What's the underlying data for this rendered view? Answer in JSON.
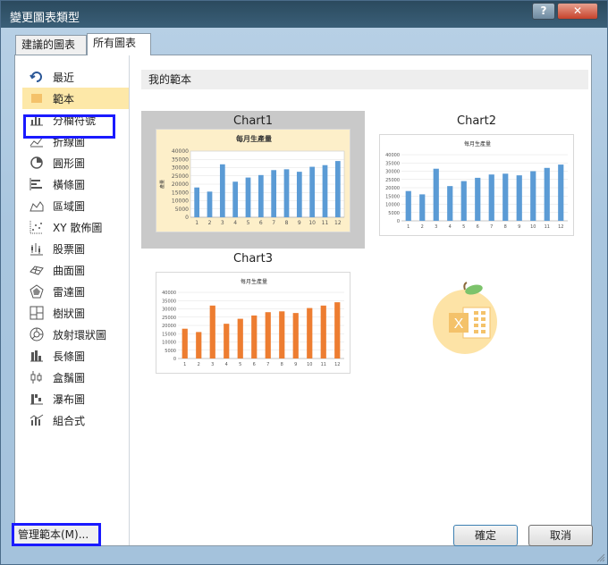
{
  "window": {
    "title": "變更圖表類型"
  },
  "tabs": [
    {
      "label": "建議的圖表",
      "active": false
    },
    {
      "label": "所有圖表",
      "active": true
    }
  ],
  "sidebar": {
    "items": [
      {
        "label": "最近",
        "icon": "recent-icon"
      },
      {
        "label": "範本",
        "icon": "folder-icon",
        "selected": true
      },
      {
        "label": "分欄符號",
        "icon": "column-chart-icon"
      },
      {
        "label": "折線圖",
        "icon": "line-chart-icon"
      },
      {
        "label": "圓形圖",
        "icon": "pie-chart-icon"
      },
      {
        "label": "橫條圖",
        "icon": "bar-chart-icon"
      },
      {
        "label": "區域圖",
        "icon": "area-chart-icon"
      },
      {
        "label": "XY 散佈圖",
        "icon": "scatter-chart-icon"
      },
      {
        "label": "股票圖",
        "icon": "stock-chart-icon"
      },
      {
        "label": "曲面圖",
        "icon": "surface-chart-icon"
      },
      {
        "label": "雷達圖",
        "icon": "radar-chart-icon"
      },
      {
        "label": "樹狀圖",
        "icon": "treemap-chart-icon"
      },
      {
        "label": "放射環狀圖",
        "icon": "sunburst-chart-icon"
      },
      {
        "label": "長條圖",
        "icon": "histogram-chart-icon"
      },
      {
        "label": "盒鬚圖",
        "icon": "box-whisker-chart-icon"
      },
      {
        "label": "瀑布圖",
        "icon": "waterfall-chart-icon"
      },
      {
        "label": "組合式",
        "icon": "combo-chart-icon"
      }
    ]
  },
  "content": {
    "section_title": "我的範本",
    "templates": [
      {
        "name": "Chart1",
        "selected": true
      },
      {
        "name": "Chart2",
        "selected": false
      },
      {
        "name": "Chart3",
        "selected": false
      }
    ]
  },
  "colors": {
    "accent_blue": "#5b9bd5",
    "accent_orange": "#ed7d31",
    "selection_bg": "#fde8a8",
    "highlight_border": "#1a1aff"
  },
  "chart_data": [
    {
      "type": "bar",
      "title": "每月生產量",
      "ylabel": "產量",
      "categories": [
        "1",
        "2",
        "3",
        "4",
        "5",
        "6",
        "7",
        "8",
        "9",
        "10",
        "11",
        "12"
      ],
      "values": [
        18000,
        15500,
        32000,
        21500,
        24000,
        25500,
        28500,
        29000,
        27500,
        30500,
        31500,
        34000
      ],
      "ylim": [
        0,
        40000
      ],
      "yticks": [
        "0",
        "5000",
        "10000",
        "15000",
        "20000",
        "25000",
        "30000",
        "35000",
        "40000"
      ],
      "color": "#5b9bd5",
      "grid": true
    },
    {
      "type": "bar",
      "title": "每月生產量",
      "categories": [
        "1",
        "2",
        "3",
        "4",
        "5",
        "6",
        "7",
        "8",
        "9",
        "10",
        "11",
        "12"
      ],
      "values": [
        18000,
        16000,
        31500,
        21000,
        24000,
        26000,
        28000,
        28500,
        27500,
        30000,
        32000,
        34000
      ],
      "ylim": [
        0,
        40000
      ],
      "yticks": [
        "0",
        "5000",
        "10000",
        "15000",
        "20000",
        "25000",
        "30000",
        "35000",
        "40000"
      ],
      "color": "#5b9bd5",
      "grid": true
    },
    {
      "type": "bar",
      "title": "每月生產量",
      "categories": [
        "1",
        "2",
        "3",
        "4",
        "5",
        "6",
        "7",
        "8",
        "9",
        "10",
        "11",
        "12"
      ],
      "values": [
        18000,
        16000,
        32000,
        21000,
        24000,
        26000,
        28000,
        28500,
        27500,
        30500,
        32000,
        34000
      ],
      "ylim": [
        0,
        40000
      ],
      "yticks": [
        "0",
        "5000",
        "10000",
        "15000",
        "20000",
        "25000",
        "30000",
        "35000",
        "40000"
      ],
      "color": "#ed7d31",
      "grid": true
    }
  ],
  "footer": {
    "manage_label": "管理範本(M)...",
    "ok_label": "確定",
    "cancel_label": "取消"
  }
}
